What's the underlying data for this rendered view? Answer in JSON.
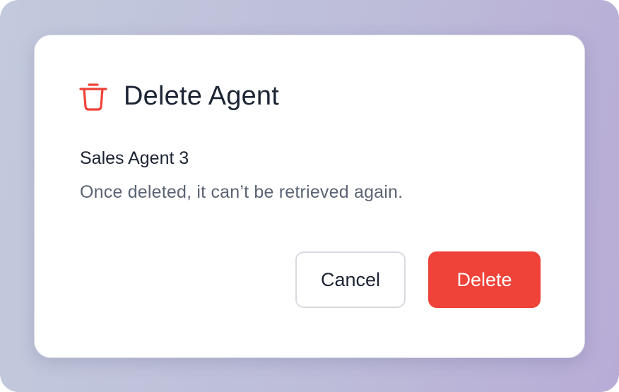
{
  "dialog": {
    "icon": "trash-icon",
    "title": "Delete Agent",
    "agent_name": "Sales Agent 3",
    "message": "Once deleted, it can’t be retrieved again.",
    "cancel_label": "Cancel",
    "delete_label": "Delete"
  },
  "colors": {
    "danger": "#ef4238",
    "text_primary": "#1c2434",
    "text_secondary": "#5b6475"
  }
}
